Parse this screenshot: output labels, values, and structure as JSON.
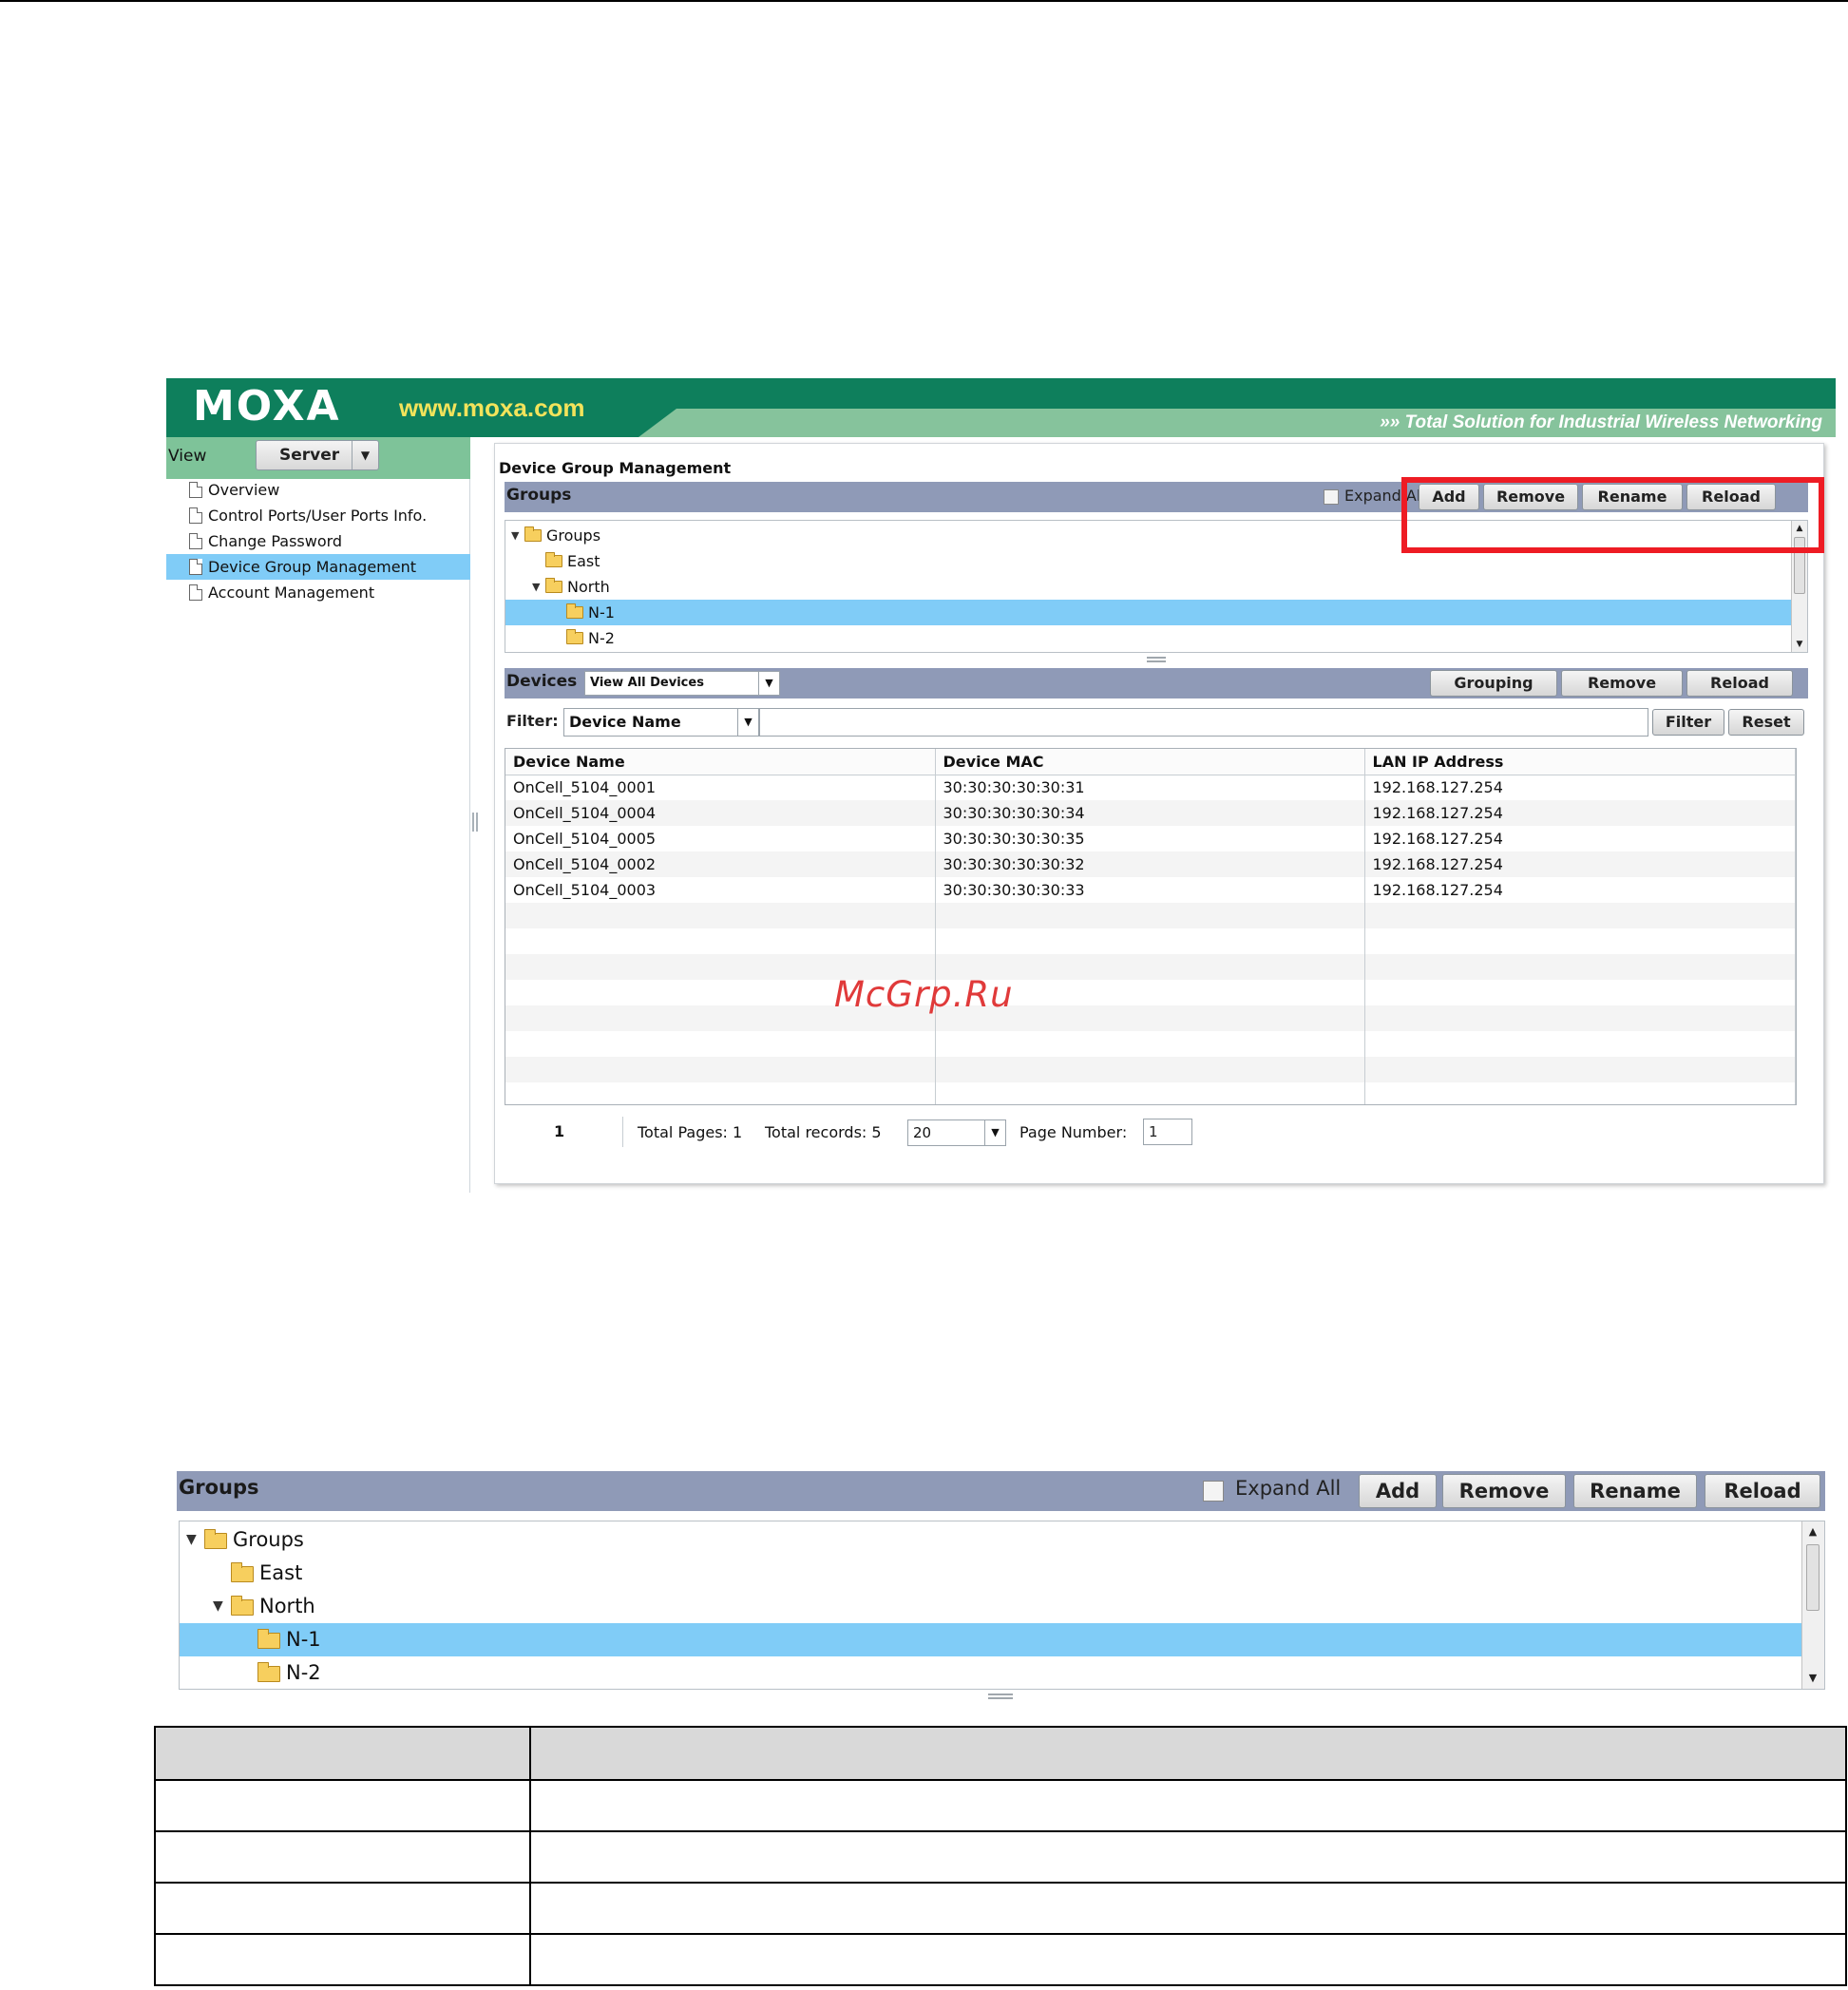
{
  "brand": {
    "logo_text": "MOXA",
    "url": "www.moxa.com",
    "tagline": "Total Solution for Industrial Wireless Networking"
  },
  "sidebar": {
    "view_label": "View",
    "view_select": "Server",
    "items": [
      {
        "label": "Overview"
      },
      {
        "label": "Control Ports/User Ports Info."
      },
      {
        "label": "Change Password"
      },
      {
        "label": "Device Group Management",
        "active": true
      },
      {
        "label": "Account Management"
      }
    ]
  },
  "panel": {
    "title": "Device Group Management"
  },
  "groups": {
    "title": "Groups",
    "expand_all": "Expand All",
    "buttons": {
      "add": "Add",
      "remove": "Remove",
      "rename": "Rename",
      "reload": "Reload"
    },
    "tree": [
      {
        "label": "Groups",
        "level": 0,
        "expanded": true
      },
      {
        "label": "East",
        "level": 1
      },
      {
        "label": "North",
        "level": 1,
        "expanded": true
      },
      {
        "label": "N-1",
        "level": 2,
        "selected": true
      },
      {
        "label": "N-2",
        "level": 2
      }
    ]
  },
  "devices": {
    "title": "Devices",
    "view_select": "View All Devices",
    "buttons": {
      "grouping": "Grouping",
      "remove": "Remove",
      "reload": "Reload"
    },
    "filter": {
      "label": "Filter:",
      "field": "Device Name",
      "value": "",
      "filter_button": "Filter",
      "reset_button": "Reset"
    },
    "columns": [
      "Device Name",
      "Device MAC",
      "LAN IP Address"
    ],
    "rows": [
      [
        "OnCell_5104_0001",
        "30:30:30:30:30:31",
        "192.168.127.254"
      ],
      [
        "OnCell_5104_0004",
        "30:30:30:30:30:34",
        "192.168.127.254"
      ],
      [
        "OnCell_5104_0005",
        "30:30:30:30:30:35",
        "192.168.127.254"
      ],
      [
        "OnCell_5104_0002",
        "30:30:30:30:30:32",
        "192.168.127.254"
      ],
      [
        "OnCell_5104_0003",
        "30:30:30:30:30:33",
        "192.168.127.254"
      ]
    ],
    "pager": {
      "current_page": "1",
      "total_pages": "Total Pages: 1",
      "total_records": "Total records: 5",
      "page_size": "20",
      "page_number_label": "Page Number:",
      "page_number_value": "1"
    }
  },
  "watermark": "McGrp.Ru",
  "colors": {
    "banner_green": "#0e7f5c",
    "light_green": "#7ec399",
    "url_yellow": "#f2e35b",
    "selection_blue": "#80ccf7",
    "bar_slate": "#8f9ab7",
    "highlight_red": "#ee1c24"
  }
}
